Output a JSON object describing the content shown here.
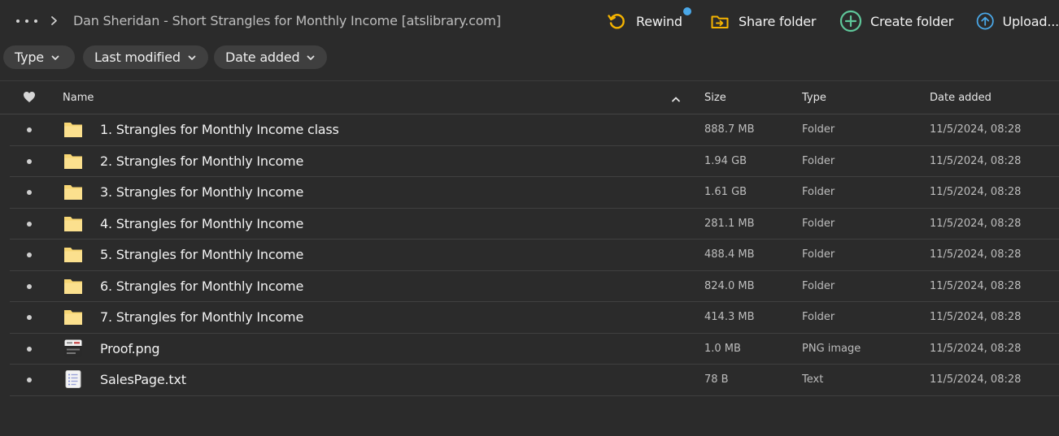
{
  "breadcrumb": {
    "more_icon": "more-horizontal-icon",
    "separator_icon": "chevron-right-icon",
    "title": "Dan Sheridan - Short Strangles for Monthly Income [atslibrary.com]"
  },
  "actions": {
    "rewind_label": "Rewind",
    "share_label": "Share folder",
    "create_label": "Create folder",
    "upload_label": "Upload..."
  },
  "filters": {
    "type_label": "Type",
    "last_modified_label": "Last modified",
    "date_added_label": "Date added"
  },
  "table": {
    "columns": {
      "name": "Name",
      "size": "Size",
      "type": "Type",
      "date_added": "Date added"
    },
    "rows": [
      {
        "name": "1. Strangles for Monthly Income class",
        "size": "888.7 MB",
        "type": "Folder",
        "date": "11/5/2024, 08:28",
        "icon": "folder-icon"
      },
      {
        "name": "2. Strangles for Monthly Income",
        "size": "1.94 GB",
        "type": "Folder",
        "date": "11/5/2024, 08:28",
        "icon": "folder-icon"
      },
      {
        "name": "3. Strangles for Monthly Income",
        "size": "1.61 GB",
        "type": "Folder",
        "date": "11/5/2024, 08:28",
        "icon": "folder-icon"
      },
      {
        "name": "4. Strangles for Monthly Income",
        "size": "281.1 MB",
        "type": "Folder",
        "date": "11/5/2024, 08:28",
        "icon": "folder-icon"
      },
      {
        "name": "5. Strangles for Monthly Income",
        "size": "488.4 MB",
        "type": "Folder",
        "date": "11/5/2024, 08:28",
        "icon": "folder-icon"
      },
      {
        "name": "6. Strangles for Monthly Income",
        "size": "824.0 MB",
        "type": "Folder",
        "date": "11/5/2024, 08:28",
        "icon": "folder-icon"
      },
      {
        "name": "7. Strangles for Monthly Income",
        "size": "414.3 MB",
        "type": "Folder",
        "date": "11/5/2024, 08:28",
        "icon": "folder-icon"
      },
      {
        "name": "Proof.png",
        "size": "1.0 MB",
        "type": "PNG image",
        "date": "11/5/2024, 08:28",
        "icon": "image-file-icon"
      },
      {
        "name": "SalesPage.txt",
        "size": "78 B",
        "type": "Text",
        "date": "11/5/2024, 08:28",
        "icon": "text-file-icon"
      }
    ]
  },
  "colors": {
    "background": "#2b2b2b",
    "rewind_accent": "#f5b400",
    "share_accent": "#f5b400",
    "create_accent": "#5fc79a",
    "upload_accent": "#4aa8e8",
    "notification_dot": "#4aa8e8",
    "folder": "#f7d674"
  }
}
